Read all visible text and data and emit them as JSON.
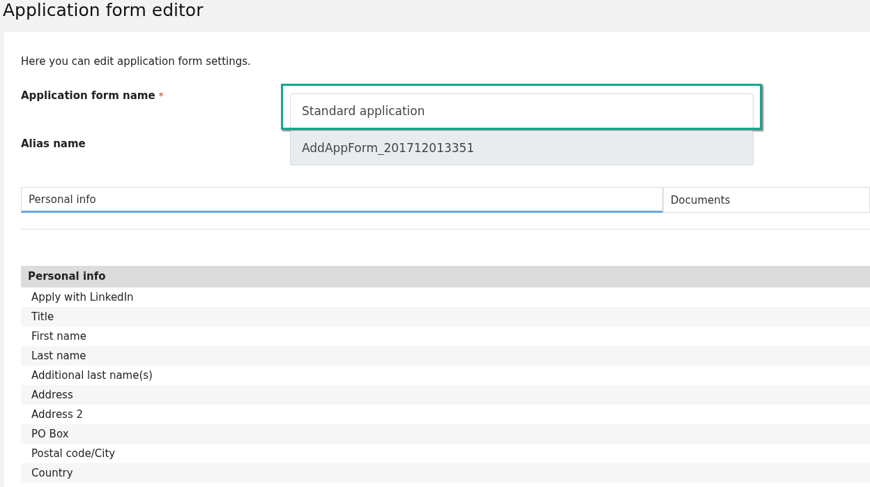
{
  "page": {
    "title": "Application form editor"
  },
  "intro": "Here you can edit application form settings.",
  "fields": [
    {
      "label": "Application form name",
      "required": true,
      "value": "Standard application",
      "disabled": false,
      "highlighted": true
    },
    {
      "label": "Alias name",
      "required": false,
      "value": "AddAppForm_201712013351",
      "disabled": true,
      "highlighted": false
    }
  ],
  "required_mark": "*",
  "tabs": [
    {
      "label": "Personal info",
      "selected": true
    },
    {
      "label": "Documents",
      "selected": false
    }
  ],
  "section": {
    "title": "Personal info",
    "rows": [
      "Apply with LinkedIn",
      "Title",
      "First name",
      "Last name",
      "Additional last name(s)",
      "Address",
      "Address 2",
      "PO Box",
      "Postal code/City",
      "Country"
    ]
  }
}
